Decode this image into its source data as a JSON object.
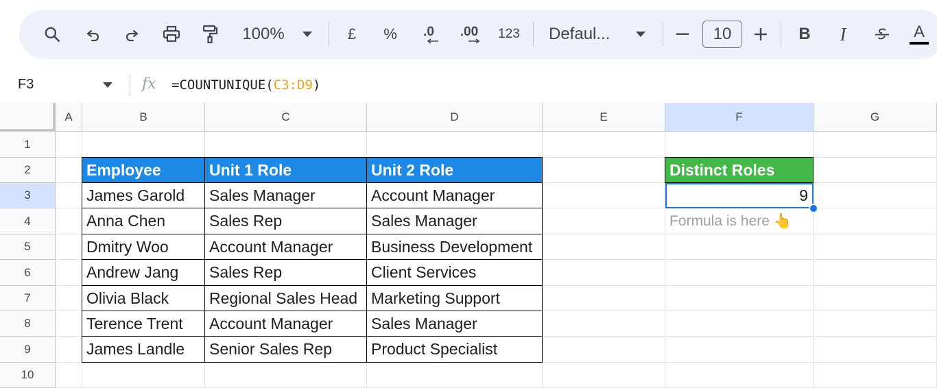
{
  "toolbar": {
    "zoom": "100%",
    "currency": "£",
    "percent": "%",
    "decrease_decimal": ".0",
    "increase_decimal": ".00",
    "number_format": "123",
    "font": "Defaul...",
    "font_size": "10",
    "bold": "B",
    "italic": "I",
    "text_color": "A"
  },
  "formula_bar": {
    "cell_ref": "F3",
    "fx": "fx",
    "formula_prefix": "=COUNTUNIQUE(",
    "formula_ref": "C3:D9",
    "formula_suffix": ")"
  },
  "columns": [
    "A",
    "B",
    "C",
    "D",
    "E",
    "F",
    "G"
  ],
  "rows": [
    "1",
    "2",
    "3",
    "4",
    "5",
    "6",
    "7",
    "8",
    "9",
    "10"
  ],
  "table": {
    "headers": [
      "Employee",
      "Unit 1 Role",
      "Unit 2 Role"
    ],
    "rows": [
      [
        "James Garold",
        "Sales Manager",
        "Account Manager"
      ],
      [
        "Anna Chen",
        "Sales Rep",
        "Sales Manager"
      ],
      [
        "Dmitry Woo",
        "Account Manager",
        "Business Development"
      ],
      [
        "Andrew Jang",
        "Sales Rep",
        "Client Services"
      ],
      [
        "Olivia Black",
        "Regional Sales Head",
        "Marketing Support"
      ],
      [
        "Terence Trent",
        "Account Manager",
        "Sales Manager"
      ],
      [
        "James Landle",
        "Senior Sales Rep",
        "Product Specialist"
      ]
    ]
  },
  "result": {
    "header": "Distinct Roles",
    "value": "9",
    "note": "Formula is here 👆"
  },
  "colors": {
    "table_header": "#1e88e5",
    "result_header": "#43b749",
    "selection": "#1a73e8",
    "formula_ref": "#e8a317"
  }
}
